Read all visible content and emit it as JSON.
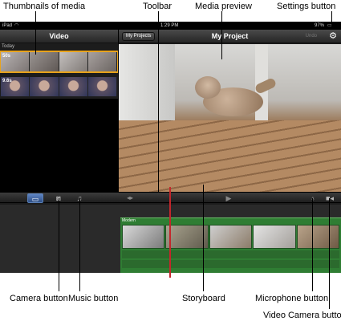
{
  "callouts": {
    "thumbnails": "Thumbnails of media",
    "toolbar": "Toolbar",
    "media_preview": "Media preview",
    "settings_button": "Settings button",
    "camera_button": "Camera button",
    "music_button": "Music button",
    "storyboard": "Storyboard",
    "microphone_button": "Microphone button",
    "video_camera_button": "Video Camera button"
  },
  "status_bar": {
    "device": "iPad",
    "time": "1:29 PM",
    "battery": "97%"
  },
  "media_browser": {
    "title": "Video",
    "section": "Today",
    "clips": [
      {
        "duration": "50s"
      },
      {
        "duration": "9.6s"
      }
    ]
  },
  "project_header": {
    "back_button": "My Projects",
    "title": "My Project",
    "undo": "Undo"
  },
  "storyboard": {
    "theme_label": "Modern"
  },
  "icons": {
    "settings": "gear-icon",
    "video_mode": "video-mode-icon",
    "camera": "camera-icon",
    "music": "music-note-icon",
    "scrub": "scrub-arrows-icon",
    "play": "play-icon",
    "microphone": "microphone-icon",
    "video_camera": "video-camera-icon"
  },
  "colors": {
    "selection_accent": "#e8a31b",
    "playhead": "#c4262b",
    "storyboard_track": "#2f7d33",
    "video_mode_button": "#4a6fa8"
  }
}
